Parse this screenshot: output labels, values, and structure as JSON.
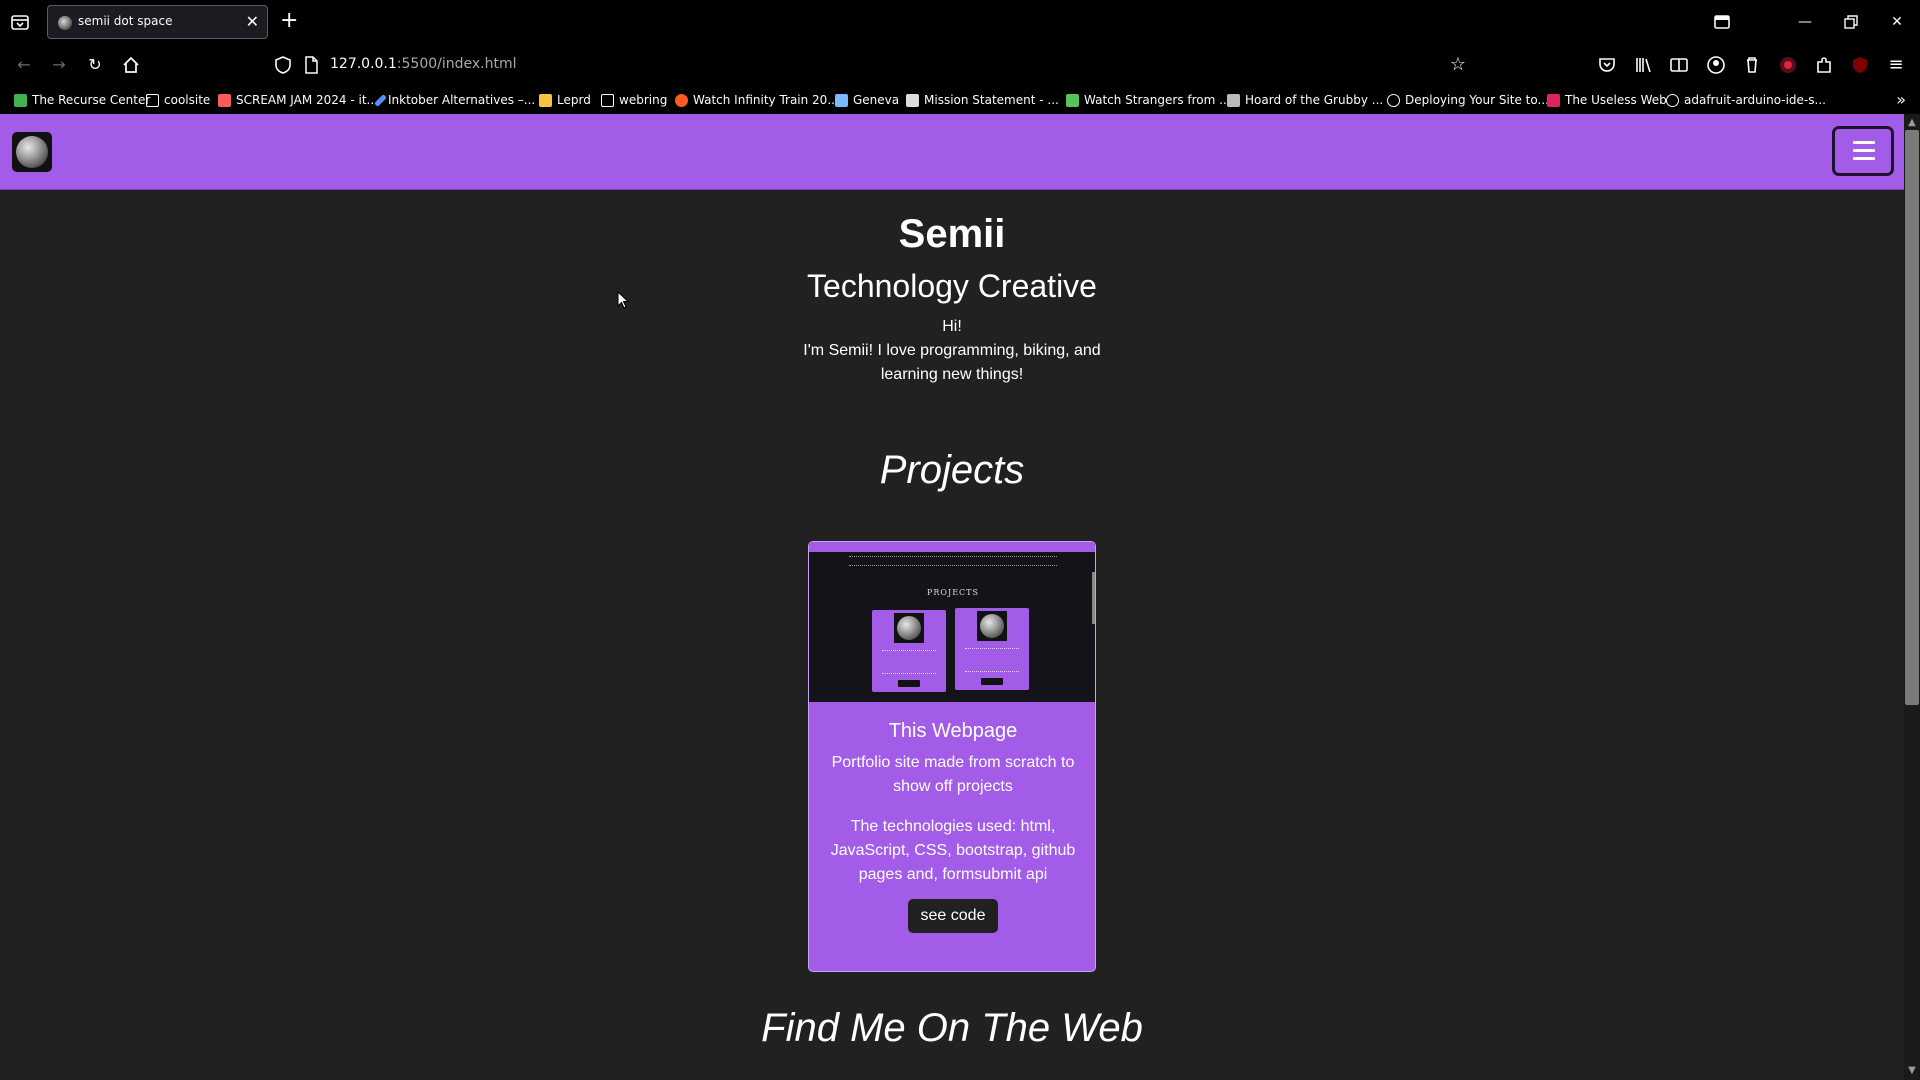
{
  "browser": {
    "tab": {
      "title": "semii dot space"
    },
    "url": {
      "host": "127.0.0.1",
      "path": ":5500/index.html"
    },
    "bookmarks": [
      {
        "label": "The Recurse Center",
        "icon": "rc-icon",
        "color": "#3fb34f"
      },
      {
        "label": "coolsite",
        "icon": "folder-icon"
      },
      {
        "label": "SCREAM JAM 2024 - it...",
        "icon": "itch-icon",
        "color": "#fa5c5c"
      },
      {
        "label": "Inktober Alternatives –...",
        "icon": "pen-icon",
        "color": "#5b8dff"
      },
      {
        "label": "Leprd",
        "icon": "leopard-icon",
        "color": "#f5c542"
      },
      {
        "label": "webring",
        "icon": "folder-icon"
      },
      {
        "label": "Watch Infinity Train 20...",
        "icon": "play-icon",
        "color": "#ff5a1f"
      },
      {
        "label": "Geneva",
        "icon": "geneva-icon",
        "color": "#7ab8ff"
      },
      {
        "label": "Mission Statement - ...",
        "icon": "page-icon",
        "color": "#dddddd"
      },
      {
        "label": "Watch Strangers from ...",
        "icon": "stripes-icon",
        "color": "#58c35a"
      },
      {
        "label": "Hoard of the Grubby ...",
        "icon": "hoard-icon",
        "color": "#bbbbbb"
      },
      {
        "label": "Deploying Your Site to...",
        "icon": "globe-icon"
      },
      {
        "label": "The Useless Web",
        "icon": "useless-icon",
        "color": "#e0245e"
      },
      {
        "label": "adafruit-arduino-ide-s...",
        "icon": "globe-icon"
      }
    ]
  },
  "site": {
    "name": "Semii",
    "tagline": "Technology Creative",
    "greeting": "Hi!",
    "bio": "I'm Semii! I love programming, biking, and learning new things!",
    "projects_heading": "Projects",
    "project": {
      "thumb_heading": "PROJECTS",
      "title": "This Webpage",
      "description": "Portfolio site made from scratch to show off projects",
      "technologies": "The technologies used: html, JavaScript, CSS, bootstrap, github pages and, formsubmit api",
      "button": "see code"
    },
    "find_heading": "Find Me On The Web",
    "accent_color": "#a35ce8"
  }
}
